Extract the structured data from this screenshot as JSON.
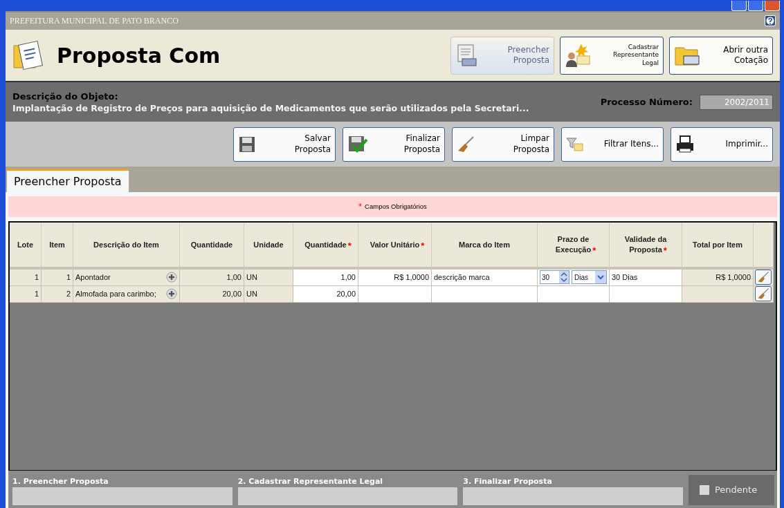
{
  "header": {
    "org": "PREFEITURA MUNICIPAL DE PATO BRANCO",
    "title": "Proposta Com"
  },
  "top_actions": [
    {
      "lines": [
        "Preencher",
        "Proposta"
      ],
      "kind": "form",
      "selected": true
    },
    {
      "lines": [
        "Cadastrar",
        "Representante",
        "Legal"
      ],
      "kind": "person",
      "selected": false
    },
    {
      "lines": [
        "Abrir outra",
        "Cotação"
      ],
      "kind": "folder",
      "selected": false
    }
  ],
  "object": {
    "label": "Descrição do Objeto:",
    "text": "Implantação de Registro de Preços para aquisição de Medicamentos que serão utilizados pela Secretari...",
    "process_label": "Processo Número:",
    "process_value": "2002/2011"
  },
  "toolbar": [
    {
      "lines": [
        "Salvar",
        "Proposta"
      ],
      "kind": "save"
    },
    {
      "lines": [
        "Finalizar",
        "Proposta"
      ],
      "kind": "finalize"
    },
    {
      "lines": [
        "Limpar",
        "Proposta"
      ],
      "kind": "broom"
    },
    {
      "lines": [
        "Filtrar Itens..."
      ],
      "kind": "filter"
    },
    {
      "lines": [
        "Imprimir..."
      ],
      "kind": "print"
    }
  ],
  "tabs": [
    {
      "label": "Preencher Proposta",
      "selected": true
    }
  ],
  "required_note": {
    "mark": "*",
    "text": "Campos Obrigatórios"
  },
  "table": {
    "columns": [
      {
        "lines": [
          "Lote"
        ],
        "required": false
      },
      {
        "lines": [
          "Item"
        ],
        "required": false
      },
      {
        "lines": [
          "Descrição do Item"
        ],
        "required": false
      },
      {
        "lines": [
          "Quantidade"
        ],
        "required": false
      },
      {
        "lines": [
          "Unidade"
        ],
        "required": false
      },
      {
        "lines": [
          "Quantidade"
        ],
        "required": true
      },
      {
        "lines": [
          "Valor Unitário"
        ],
        "required": true
      },
      {
        "lines": [
          "Marca do Item"
        ],
        "required": false
      },
      {
        "lines": [
          "Prazo de",
          "Execução"
        ],
        "required": true
      },
      {
        "lines": [
          "Validade da",
          "Proposta"
        ],
        "required": true
      },
      {
        "lines": [
          "Total por Item"
        ],
        "required": false
      }
    ],
    "rows": [
      {
        "lote": "1",
        "item": "1",
        "descricao": "Apontador",
        "quantidade": "1,00",
        "unidade": "UN",
        "quantidade_proposta": "1,00",
        "valor_unitario": "R$ 1,0000",
        "marca": "descrição marca",
        "prazo": {
          "value": "30",
          "unit": "Dias"
        },
        "validade": "30 Dias",
        "total": "R$ 1,0000"
      },
      {
        "lote": "1",
        "item": "2",
        "descricao": "Almofada para carimbo;",
        "quantidade": "20,00",
        "unidade": "UN",
        "quantidade_proposta": "20,00"
      }
    ]
  },
  "steps": [
    {
      "label": "1. Preencher Proposta"
    },
    {
      "label": "2. Cadastrar Representante Legal"
    },
    {
      "label": "3. Finalizar Proposta"
    }
  ],
  "legend": [
    {
      "label": "Pendente",
      "color": "#d8d8d8"
    }
  ]
}
